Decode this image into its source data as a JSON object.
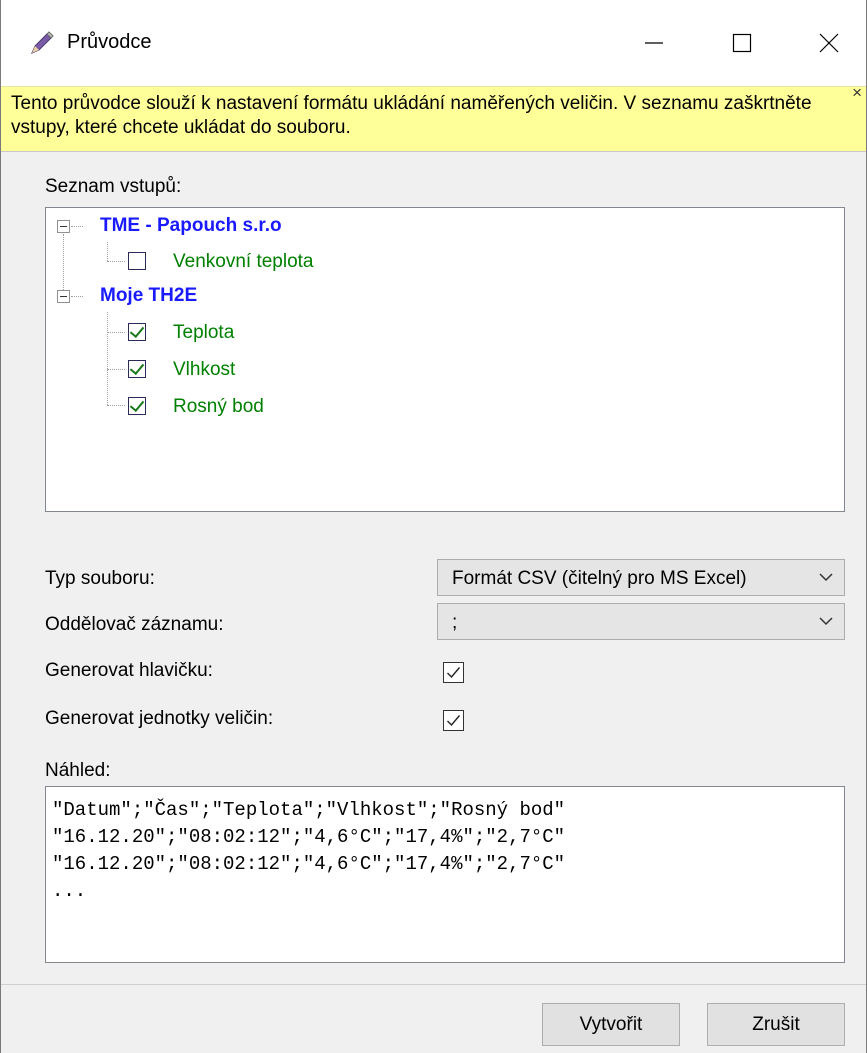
{
  "window": {
    "title": "Průvodce",
    "controls": {
      "minimize": "—",
      "maximize": "☐",
      "close": "✕"
    }
  },
  "info": {
    "text": "Tento průvodce slouží k nastavení formátu ukládání naměřených veličin. V seznamu zaškrtněte vstupy, které chcete ukládat do souboru.",
    "close": "×"
  },
  "inputs": {
    "label": "Seznam vstupů:",
    "groups": [
      {
        "name": "TME - Papouch s.r.o",
        "expanded": true,
        "items": [
          {
            "label": "Venkovní teplota",
            "checked": false
          }
        ]
      },
      {
        "name": "Moje TH2E",
        "expanded": true,
        "items": [
          {
            "label": "Teplota",
            "checked": true
          },
          {
            "label": "Vlhkost",
            "checked": true
          },
          {
            "label": "Rosný bod",
            "checked": true
          }
        ]
      }
    ]
  },
  "settings": {
    "file_type": {
      "label": "Typ souboru:",
      "value": "Formát CSV (čitelný pro MS Excel)"
    },
    "separator": {
      "label": "Oddělovač záznamu:",
      "value": ";"
    },
    "header": {
      "label": "Generovat hlavičku:",
      "checked": true
    },
    "units": {
      "label": "Generovat jednotky veličin:",
      "checked": true
    }
  },
  "preview": {
    "label": "Náhled:",
    "lines": [
      "\"Datum\";\"Čas\";\"Teplota\";\"Vlhkost\";\"Rosný bod\"",
      "\"16.12.20\";\"08:02:12\";\"4,6°C\";\"17,4%\";\"2,7°C\"",
      "\"16.12.20\";\"08:02:12\";\"4,6°C\";\"17,4%\";\"2,7°C\"",
      "..."
    ]
  },
  "buttons": {
    "create": "Vytvořit",
    "cancel": "Zrušit"
  },
  "colors": {
    "info_bg": "#ffff99",
    "group_label": "#1a1aff",
    "item_label": "#008000"
  }
}
